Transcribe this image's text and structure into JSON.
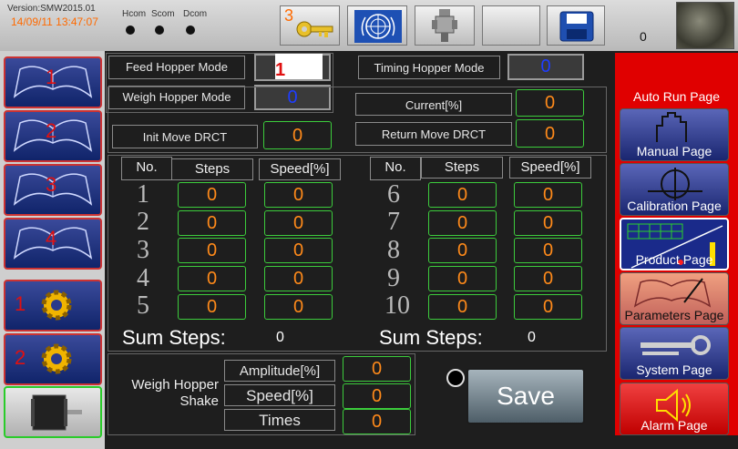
{
  "header": {
    "version": "Version:SMW2015.01",
    "datetime": "14/09/11 13:47:07",
    "ports": [
      "Hcom",
      "Scom",
      "Dcom"
    ],
    "key_badge": "3",
    "counter": "0"
  },
  "sidebar_left": {
    "items": [
      {
        "label": "1"
      },
      {
        "label": "2"
      },
      {
        "label": "3"
      },
      {
        "label": "4"
      },
      {
        "label": "1"
      },
      {
        "label": "2"
      },
      {
        "label": ""
      }
    ]
  },
  "sidebar_right": {
    "title": "Auto Run Page",
    "items": [
      "Manual Page",
      "Calibration Page",
      "Product Page",
      "Parameters Page",
      "System Page",
      "Alarm Page"
    ]
  },
  "modes": {
    "feed_label": "Feed Hopper Mode",
    "feed_value": "1",
    "weigh_label": "Weigh Hopper Mode",
    "weigh_value": "0",
    "timing_label": "Timing Hopper Mode",
    "timing_value": "0",
    "current_label": "Current[%]",
    "current_value": "0",
    "init_label": "Init Move DRCT",
    "init_value": "0",
    "return_label": "Return Move DRCT",
    "return_value": "0"
  },
  "table": {
    "headers": [
      "No.",
      "Steps",
      "Speed[%]"
    ],
    "left": [
      {
        "no": "1",
        "steps": "0",
        "speed": "0"
      },
      {
        "no": "2",
        "steps": "0",
        "speed": "0"
      },
      {
        "no": "3",
        "steps": "0",
        "speed": "0"
      },
      {
        "no": "4",
        "steps": "0",
        "speed": "0"
      },
      {
        "no": "5",
        "steps": "0",
        "speed": "0"
      }
    ],
    "right": [
      {
        "no": "6",
        "steps": "0",
        "speed": "0"
      },
      {
        "no": "7",
        "steps": "0",
        "speed": "0"
      },
      {
        "no": "8",
        "steps": "0",
        "speed": "0"
      },
      {
        "no": "9",
        "steps": "0",
        "speed": "0"
      },
      {
        "no": "10",
        "steps": "0",
        "speed": "0"
      }
    ],
    "sum_label": "Sum Steps:",
    "sum_left": "0",
    "sum_right": "0"
  },
  "shake": {
    "title": "Weigh Hopper Shake",
    "amplitude_label": "Amplitude[%]",
    "amplitude_value": "0",
    "speed_label": "Speed[%]",
    "speed_value": "0",
    "times_label": "Times",
    "times_value": "0"
  },
  "save_label": "Save",
  "colors": {
    "accent_red": "#e00000",
    "value_orange": "#ff8a1a",
    "value_blue": "#1e3dff",
    "green_border": "#3ccc3c"
  }
}
